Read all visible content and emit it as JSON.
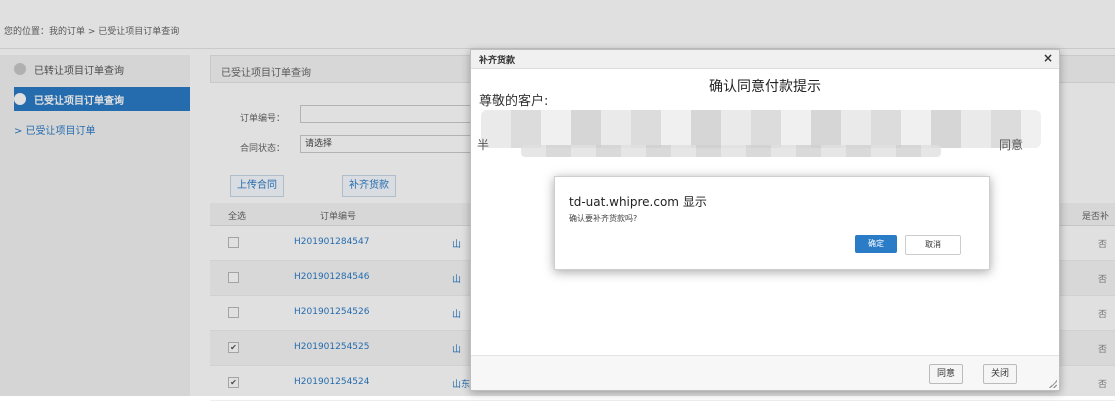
{
  "breadcrumb": "您的位置：我的订单 > 已受让项目订单查询",
  "sidebar": {
    "items": [
      {
        "label": "已转让项目订单查询"
      },
      {
        "label": "已受让项目订单查询"
      },
      {
        "label": "> 已受让项目订单"
      }
    ]
  },
  "main": {
    "panel_title": "已受让项目订单查询",
    "form": {
      "order_no_label": "订单编号：",
      "contract_status_label": "合同状态：",
      "contract_status_value": "请选择"
    },
    "toolbar": {
      "upload_label": "上传合同",
      "supplement_label": "补齐货款"
    },
    "table": {
      "headers": [
        "全选",
        "订单编号",
        "是否补"
      ],
      "rows": [
        {
          "checked": false,
          "order_no": "H201901284547",
          "corp": "山",
          "tail": "否"
        },
        {
          "checked": false,
          "order_no": "H201901284546",
          "corp": "山",
          "tail": "否"
        },
        {
          "checked": false,
          "order_no": "H201901254526",
          "corp": "山",
          "tail": "否"
        },
        {
          "checked": true,
          "order_no": "H201901254525",
          "corp": "山",
          "tail": "否"
        },
        {
          "checked": true,
          "order_no": "H201901254524",
          "corp": "山东莱阳市银行有限公司",
          "tail": "否"
        }
      ]
    }
  },
  "modal": {
    "header_title": "补齐货款",
    "close_glyph": "×",
    "title": "确认同意付款提示",
    "greeting": "尊敬的客户:",
    "trail_left": "半",
    "trail_right": "同意",
    "agree_label": "同意",
    "close_label": "关闭"
  },
  "confirm": {
    "host": "td-uat.whipre.com 显示",
    "message": "确认要补齐货款吗?",
    "ok_label": "确定",
    "cancel_label": "取消"
  },
  "colors": {
    "accent": "#2b7cc7"
  }
}
